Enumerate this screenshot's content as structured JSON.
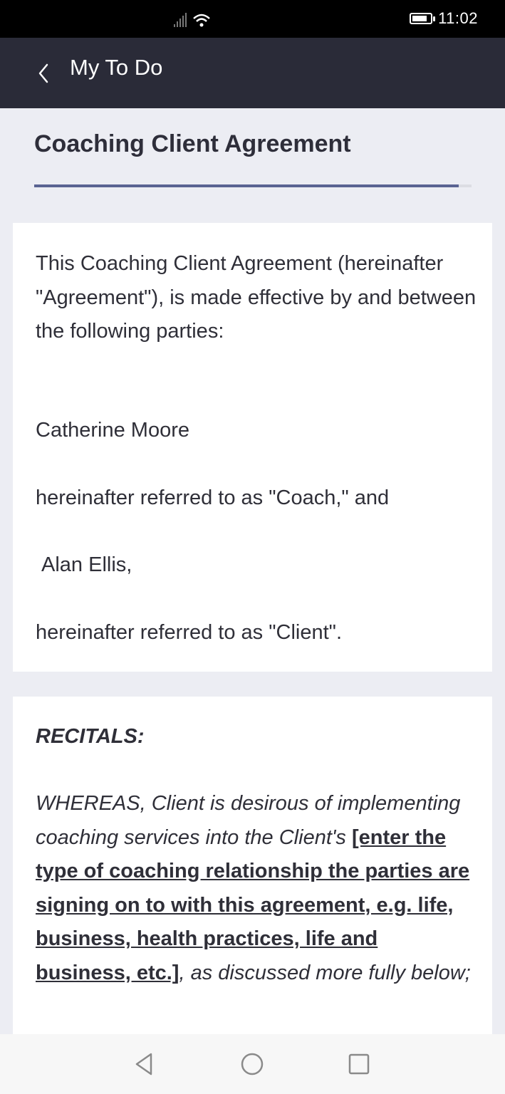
{
  "status_bar": {
    "time": "11:02",
    "battery_level": 0.85,
    "icons": [
      "signal-icon",
      "wifi-icon",
      "battery-icon"
    ]
  },
  "header": {
    "back_icon": "chevron-left-icon",
    "title": "My To Do"
  },
  "page": {
    "title": "Coaching Client Agreement",
    "progress": 0.97
  },
  "card1": {
    "intro": "This Coaching Client Agreement (hereinafter \"Agreement\"), is made effective by and between the following parties:",
    "coach_name": "Catherine Moore",
    "coach_ref": "hereinafter referred to as \"Coach,\" and",
    "client_name": "Alan Ellis,",
    "client_ref": "hereinafter referred to as \"Client\"."
  },
  "card2": {
    "heading": "RECITALS:",
    "whereas_start": "WHEREAS, Client is desirous of implementing coaching services into the Client's ",
    "placeholder": "[enter the type of coaching relationship the parties are signing on to with this agreement, e.g. life, business, health practices, life and business, etc.]",
    "whereas_end": ", as discussed more fully below;"
  },
  "nav": {
    "icons": [
      "back-triangle-icon",
      "home-circle-icon",
      "recents-square-icon"
    ]
  },
  "colors": {
    "header_bg": "#2a2b38",
    "page_bg": "#ecedf3",
    "accent": "#5a6392"
  }
}
